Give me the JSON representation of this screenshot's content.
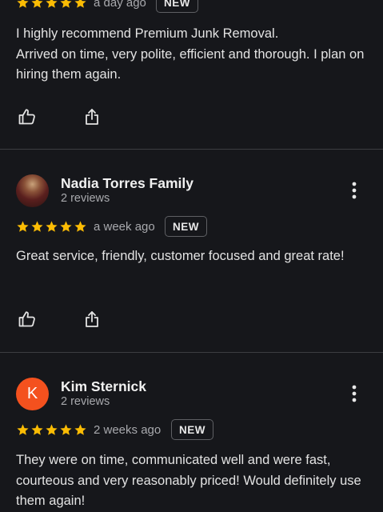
{
  "colors": {
    "background": "#16171b",
    "star": "#fbbc04",
    "divider": "#3c3d41",
    "kim_avatar": "#f4511e"
  },
  "icons": {
    "rating": "star-icon",
    "like": "thumbs-up-icon",
    "share": "share-icon",
    "menu": "more-vertical-icon"
  },
  "reviews": [
    {
      "reviewer": "",
      "review_count": "",
      "rating": 5,
      "date": "a day ago",
      "badge": "NEW",
      "text": "I highly recommend Premium Junk Removal.\nArrived on time, very polite, efficient and thorough. I plan on hiring them again."
    },
    {
      "reviewer": "Nadia Torres Family",
      "review_count": "2 reviews",
      "rating": 5,
      "date": "a week ago",
      "badge": "NEW",
      "text": "Great service, friendly, customer focused and great rate!"
    },
    {
      "reviewer": "Kim Sternick",
      "avatar_letter": "K",
      "review_count": "2 reviews",
      "rating": 5,
      "date": "2 weeks ago",
      "badge": "NEW",
      "text": "They were on time, communicated well and were fast, courteous and very reasonably priced! Would definitely use them again!"
    }
  ]
}
